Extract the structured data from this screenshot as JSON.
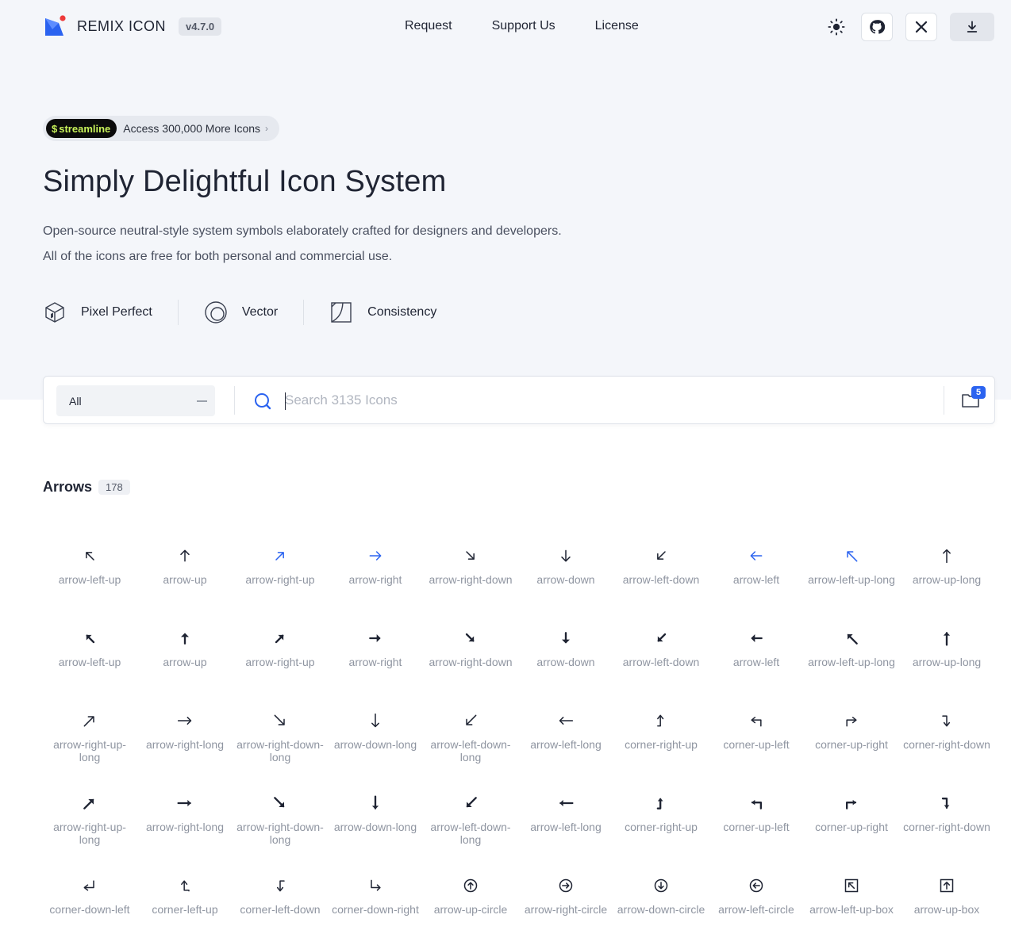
{
  "brand": {
    "name": "REMIX ICON",
    "version": "v4.7.0"
  },
  "nav": [
    {
      "label": "Request"
    },
    {
      "label": "Support Us"
    },
    {
      "label": "License"
    }
  ],
  "header_actions": {
    "theme_icon": "sun-icon",
    "github_icon": "github-icon",
    "x_icon": "x-icon",
    "download_icon": "download-icon"
  },
  "promo": {
    "badge": "streamline",
    "text": "Access 300,000 More Icons"
  },
  "hero": {
    "title": "Simply Delightful Icon System",
    "line1": "Open-source neutral-style system symbols elaborately crafted for designers and developers.",
    "line2": "All of the icons are free for both personal and commercial use."
  },
  "features": [
    {
      "label": "Pixel Perfect",
      "icon": "box-icon"
    },
    {
      "label": "Vector",
      "icon": "circles-icon"
    },
    {
      "label": "Consistency",
      "icon": "square-curve-icon"
    }
  ],
  "search": {
    "category": "All",
    "placeholder": "Search 3135 Icons",
    "collection_count": "5"
  },
  "category": {
    "title": "Arrows",
    "count": "178"
  },
  "colors": {
    "accent": "#2b63f0",
    "text": "#1f2433",
    "muted": "#8f95a1",
    "hero_bg": "#f4f6fa"
  },
  "icons": [
    {
      "label": "arrow-left-up",
      "shape": "ne",
      "rot": -90,
      "style": "line",
      "highlight": false
    },
    {
      "label": "arrow-up",
      "shape": "long",
      "rot": 0,
      "style": "line",
      "highlight": false
    },
    {
      "label": "arrow-right-up",
      "shape": "ne",
      "rot": 0,
      "style": "line",
      "highlight": true
    },
    {
      "label": "arrow-right",
      "shape": "long",
      "rot": 90,
      "style": "line",
      "highlight": true
    },
    {
      "label": "arrow-right-down",
      "shape": "ne",
      "rot": 90,
      "style": "line",
      "highlight": false
    },
    {
      "label": "arrow-down",
      "shape": "long",
      "rot": 180,
      "style": "line",
      "highlight": false
    },
    {
      "label": "arrow-left-down",
      "shape": "ne",
      "rot": 180,
      "style": "line",
      "highlight": false
    },
    {
      "label": "arrow-left",
      "shape": "long",
      "rot": 270,
      "style": "line",
      "highlight": true
    },
    {
      "label": "arrow-left-up-long",
      "shape": "nelong",
      "rot": -90,
      "style": "line",
      "highlight": true
    },
    {
      "label": "arrow-up-long",
      "shape": "xlong",
      "rot": 0,
      "style": "line",
      "highlight": false
    },
    {
      "label": "arrow-left-up",
      "shape": "ne",
      "rot": -90,
      "style": "fill",
      "highlight": false
    },
    {
      "label": "arrow-up",
      "shape": "long",
      "rot": 0,
      "style": "fill",
      "highlight": false
    },
    {
      "label": "arrow-right-up",
      "shape": "ne",
      "rot": 0,
      "style": "fill",
      "highlight": false
    },
    {
      "label": "arrow-right",
      "shape": "long",
      "rot": 90,
      "style": "fill",
      "highlight": false
    },
    {
      "label": "arrow-right-down",
      "shape": "ne",
      "rot": 90,
      "style": "fill",
      "highlight": false
    },
    {
      "label": "arrow-down",
      "shape": "long",
      "rot": 180,
      "style": "fill",
      "highlight": false
    },
    {
      "label": "arrow-left-down",
      "shape": "ne",
      "rot": 180,
      "style": "fill",
      "highlight": false
    },
    {
      "label": "arrow-left",
      "shape": "long",
      "rot": 270,
      "style": "fill",
      "highlight": false
    },
    {
      "label": "arrow-left-up-long",
      "shape": "nelong",
      "rot": -90,
      "style": "fill",
      "highlight": false
    },
    {
      "label": "arrow-up-long",
      "shape": "xlong",
      "rot": 0,
      "style": "fill",
      "highlight": false
    },
    {
      "label": "arrow-right-up-long",
      "shape": "nelong",
      "rot": 0,
      "style": "line",
      "highlight": false
    },
    {
      "label": "arrow-right-long",
      "shape": "xlong",
      "rot": 90,
      "style": "line",
      "highlight": false
    },
    {
      "label": "arrow-right-down-long",
      "shape": "nelong",
      "rot": 90,
      "style": "line",
      "highlight": false
    },
    {
      "label": "arrow-down-long",
      "shape": "xlong",
      "rot": 180,
      "style": "line",
      "highlight": false
    },
    {
      "label": "arrow-left-down-long",
      "shape": "nelong",
      "rot": 180,
      "style": "line",
      "highlight": false
    },
    {
      "label": "arrow-left-long",
      "shape": "xlong",
      "rot": 270,
      "style": "line",
      "highlight": false
    },
    {
      "label": "corner-right-up",
      "shape": "cru",
      "rot": 0,
      "style": "line",
      "highlight": false
    },
    {
      "label": "corner-up-left",
      "shape": "cul",
      "rot": 0,
      "style": "line",
      "highlight": false
    },
    {
      "label": "corner-up-right",
      "shape": "cur",
      "rot": 0,
      "style": "line",
      "highlight": false
    },
    {
      "label": "corner-right-down",
      "shape": "crd",
      "rot": 0,
      "style": "line",
      "highlight": false
    },
    {
      "label": "arrow-right-up-long",
      "shape": "nelong",
      "rot": 0,
      "style": "fill",
      "highlight": false
    },
    {
      "label": "arrow-right-long",
      "shape": "xlong",
      "rot": 90,
      "style": "fill",
      "highlight": false
    },
    {
      "label": "arrow-right-down-long",
      "shape": "nelong",
      "rot": 90,
      "style": "fill",
      "highlight": false
    },
    {
      "label": "arrow-down-long",
      "shape": "xlong",
      "rot": 180,
      "style": "fill",
      "highlight": false
    },
    {
      "label": "arrow-left-down-long",
      "shape": "nelong",
      "rot": 180,
      "style": "fill",
      "highlight": false
    },
    {
      "label": "arrow-left-long",
      "shape": "xlong",
      "rot": 270,
      "style": "fill",
      "highlight": false
    },
    {
      "label": "corner-right-up",
      "shape": "cru",
      "rot": 0,
      "style": "fill",
      "highlight": false
    },
    {
      "label": "corner-up-left",
      "shape": "cul",
      "rot": 0,
      "style": "fill",
      "highlight": false
    },
    {
      "label": "corner-up-right",
      "shape": "cur",
      "rot": 0,
      "style": "fill",
      "highlight": false
    },
    {
      "label": "corner-right-down",
      "shape": "crd",
      "rot": 0,
      "style": "fill",
      "highlight": false
    },
    {
      "label": "corner-down-left",
      "shape": "cdl",
      "rot": 0,
      "style": "line",
      "highlight": false
    },
    {
      "label": "corner-left-up",
      "shape": "clu",
      "rot": 0,
      "style": "line",
      "highlight": false
    },
    {
      "label": "corner-left-down",
      "shape": "cld",
      "rot": 0,
      "style": "line",
      "highlight": false
    },
    {
      "label": "corner-down-right",
      "shape": "cdr",
      "rot": 0,
      "style": "line",
      "highlight": false
    },
    {
      "label": "arrow-up-circle",
      "shape": "circle",
      "rot": 0,
      "style": "line",
      "highlight": false
    },
    {
      "label": "arrow-right-circle",
      "shape": "circle",
      "rot": 90,
      "style": "line",
      "highlight": false
    },
    {
      "label": "arrow-down-circle",
      "shape": "circle",
      "rot": 180,
      "style": "line",
      "highlight": false
    },
    {
      "label": "arrow-left-circle",
      "shape": "circle",
      "rot": 270,
      "style": "line",
      "highlight": false
    },
    {
      "label": "arrow-left-up-box",
      "shape": "box",
      "rot": -90,
      "style": "line",
      "highlight": false
    },
    {
      "label": "arrow-up-box",
      "shape": "boxup",
      "rot": 0,
      "style": "line",
      "highlight": false
    }
  ]
}
